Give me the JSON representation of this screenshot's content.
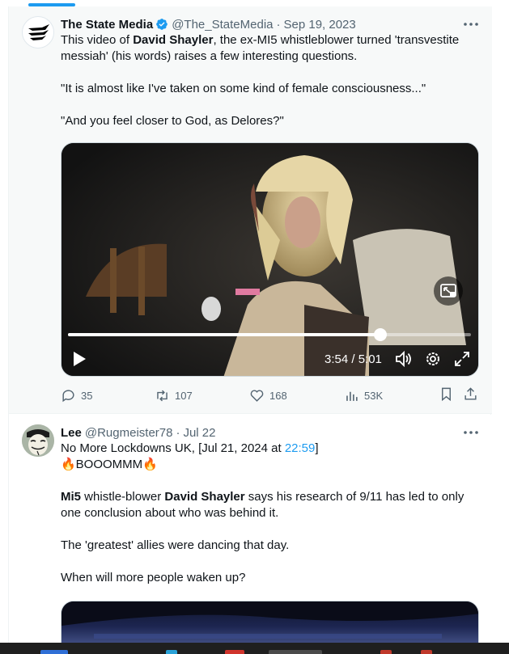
{
  "tweets": [
    {
      "name": "The State Media",
      "handle": "@The_StateMedia",
      "separator": "·",
      "date": "Sep 19, 2023",
      "text": {
        "line1_a": "This video of ",
        "line1_b": "David Shayler",
        "line1_c": ", the ex-MI5 whistleblower turned 'transvestite messiah' (his words) raises a few interesting questions.",
        "quote1": "\"It is almost like I've taken on some kind of female consciousness...\"",
        "quote2": "\"And you feel closer to God, as Delores?\""
      },
      "video": {
        "time_readout": "3:54 / 5:01",
        "progress_fraction": 0.776
      },
      "stats": {
        "replies": "35",
        "retweets": "107",
        "likes": "168",
        "views": "53K"
      }
    },
    {
      "name": "Lee",
      "handle": "@Rugmeister78",
      "separator": "·",
      "date": "Jul 22",
      "text": {
        "line1_a": "No More Lockdowns UK, [Jul 21, 2024 at ",
        "line1_link": "22:59",
        "line1_c": "]",
        "line2": "🔥BOOOMMM🔥",
        "para2_a": "Mi5",
        "para2_b": " whistle-blower ",
        "para2_c": "David Shayler",
        "para2_d": " says his research of 9/11 has led to only one conclusion about who was behind it.",
        "para3": "The 'greatest' allies were dancing that day.",
        "para4": "When will more people waken up?"
      }
    }
  ],
  "colors": {
    "accent": "#1d9bf0",
    "secondary_text": "#536471",
    "primary_text": "#0f1419"
  },
  "icons": {
    "more": "more-horizontal-icon",
    "verified": "verified-badge-icon",
    "reply": "reply-icon",
    "retweet": "retweet-icon",
    "like": "heart-icon",
    "views": "views-icon",
    "bookmark": "bookmark-icon",
    "share": "share-icon",
    "play": "play-icon",
    "volume": "volume-icon",
    "settings": "settings-icon",
    "fullscreen": "fullscreen-icon",
    "pip": "picture-in-picture-icon"
  }
}
